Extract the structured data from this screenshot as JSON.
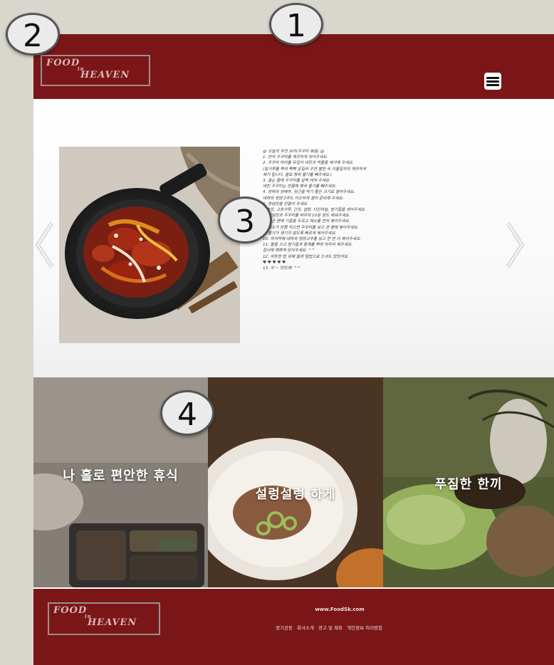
{
  "header": {
    "logo_line1": "FOOD",
    "logo_amp": "in",
    "logo_line2": "HEAVEN",
    "menu_icon": "hamburger-menu-icon"
  },
  "slider": {
    "prev_icon": "chevron-left-icon",
    "next_icon": "chevron-right-icon",
    "image_subject": "spicy stir-fried webfoot octopus in cast iron pan",
    "recipe_lines": [
      "@ 오늘의 추천 요리(주꾸미 볶음) @",
      "1. 먼저 주꾸미를 깨끗하게 씻어주세요.",
      "2. 주꾸미 머리를 뒤집어 내장과 먹물을 제거해 주세요.",
      "   (밀가루를 뿌려 빡빡 문질러 주면 빨판 속 이물질까지 깨끗하게",
      "   제거 됩니다. 물로 헹궈 물기를 빼주세요.)",
      "3. 끓는 물에 주꾸미를 살짝 데쳐 주세요.",
      "   데친 주꾸미는 찬물에 헹궈 물기를 빼주세요.",
      "4. 양파와 양배추, 당근을 먹기 좋은 크기로 썰어주세요.",
      "   대파와 청양고추도 어슷하게 썰어 준비해 주세요.",
      "5. 양념장을 만들어 주세요.",
      "   고추장, 고춧가루, 간장, 설탕, 다진마늘, 참기름을 섞어주세요.",
      "6. 양념장과 주꾸미를 버무려 10분 정도 재워주세요.",
      "7. 달군 팬에 기름을 두르고 채소를 먼저 볶아주세요.",
      "8. 채소가 반쯤 익으면 주꾸미를 넣고 센 불에 볶아주세요.",
      "9. 물기가 생기지 않도록 빠르게 볶아주세요.",
      "10. 마지막에 대파와 청양고추를 넣고 한 번 더 볶아주세요.",
      "11. 불을 끄고 참기름과 통깨를 뿌려 마무리 해주세요.",
      "   접시에 예쁘게 담아주세요. ^^",
      "12. 따뜻한 밥 위에 올려 덮밥으로 드셔도 맛있어요.",
      "   ♥ ♥ ♥ ♥ ♥",
      "13. 자 ~ 맛있게! ^^"
    ]
  },
  "banners": [
    {
      "caption": "나 홀로 편안한 휴식"
    },
    {
      "caption": "설렁설렁 하게"
    },
    {
      "caption": "푸짐한 한끼"
    }
  ],
  "footer": {
    "logo_line1": "FOOD",
    "logo_amp": "in",
    "logo_line2": "HEAVEN",
    "url": "www.FoodSk.com",
    "links": [
      "경기공동",
      "회사소개",
      "광고 및 제휴",
      "개인정보 처리방침"
    ]
  },
  "markers": [
    "1",
    "2",
    "3",
    "4"
  ],
  "colors": {
    "brand_red": "#7b1618",
    "page_bg": "#d9d6cd",
    "logo_border": "#9b8f8f"
  }
}
